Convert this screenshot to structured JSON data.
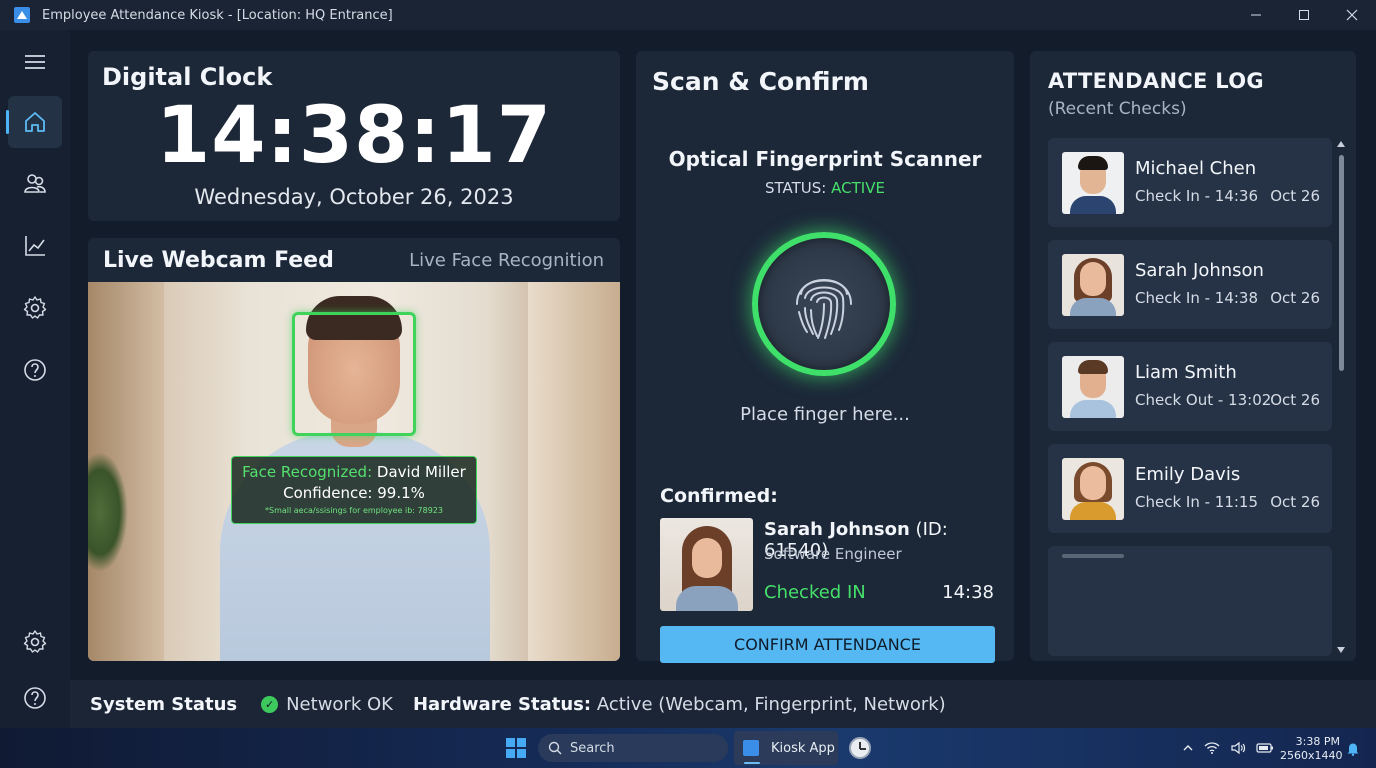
{
  "window": {
    "title": "Employee Attendance Kiosk - [Location: HQ Entrance]",
    "minimize_icon": "minimize-icon",
    "maximize_icon": "maximize-icon",
    "close_icon": "close-icon"
  },
  "sidebar": {
    "items": [
      {
        "icon": "hamburger-menu-icon"
      },
      {
        "icon": "home-icon",
        "active": true
      },
      {
        "icon": "users-icon"
      },
      {
        "icon": "chart-icon"
      },
      {
        "icon": "gear-icon"
      },
      {
        "icon": "help-icon"
      },
      {
        "icon": "gear-icon"
      },
      {
        "icon": "help-icon"
      }
    ]
  },
  "clock": {
    "label": "Digital Clock",
    "time": "14:38:17",
    "date": "Wednesday, October 26, 2023"
  },
  "webcam": {
    "title": "Live Webcam Feed",
    "subtitle": "Live Face Recognition",
    "recognized_prefix": "Face Recognized:",
    "recognized_name": "David Miller",
    "confidence": "Confidence: 99.1%",
    "fine_print": "*Small aeca/ssisings for employee ib: 78923",
    "accent": "#3fd35c"
  },
  "scan": {
    "title": "Scan & Confirm",
    "scanner_title": "Optical Fingerprint Scanner",
    "status_label": "STATUS:",
    "status_value": "ACTIVE",
    "prompt": "Place finger here...",
    "confirmed_label": "Confirmed:",
    "confirmed_name": "Sarah Johnson",
    "confirmed_id": "(ID: 61540)",
    "confirmed_role": "Software Engineer",
    "confirmed_state": "Checked IN",
    "confirmed_time": "14:38",
    "confirm_button": "CONFIRM ATTENDANCE",
    "accent": "#46e06a",
    "button_color": "#56b8f2"
  },
  "log": {
    "title": "ATTENDANCE LOG",
    "subtitle": "(Recent Checks)",
    "entries": [
      {
        "name": "Michael Chen",
        "detail": "Check In - 14:36",
        "date": "Oct 26"
      },
      {
        "name": "Sarah Johnson",
        "detail": "Check In - 14:38",
        "date": "Oct 26"
      },
      {
        "name": "Liam Smith",
        "detail": "Check Out - 13:02",
        "date": "Oct 26"
      },
      {
        "name": "Emily Davis",
        "detail": "Check In - 11:15",
        "date": "Oct 26"
      }
    ]
  },
  "status": {
    "label": "System Status",
    "network": "Network OK",
    "hardware_label": "Hardware Status:",
    "hardware_value": "Active (Webcam, Fingerprint, Network)"
  },
  "taskbar": {
    "search_label": "Search",
    "app_label": "Kiosk App",
    "time": "3:38 PM",
    "resolution": "2560x1440"
  }
}
